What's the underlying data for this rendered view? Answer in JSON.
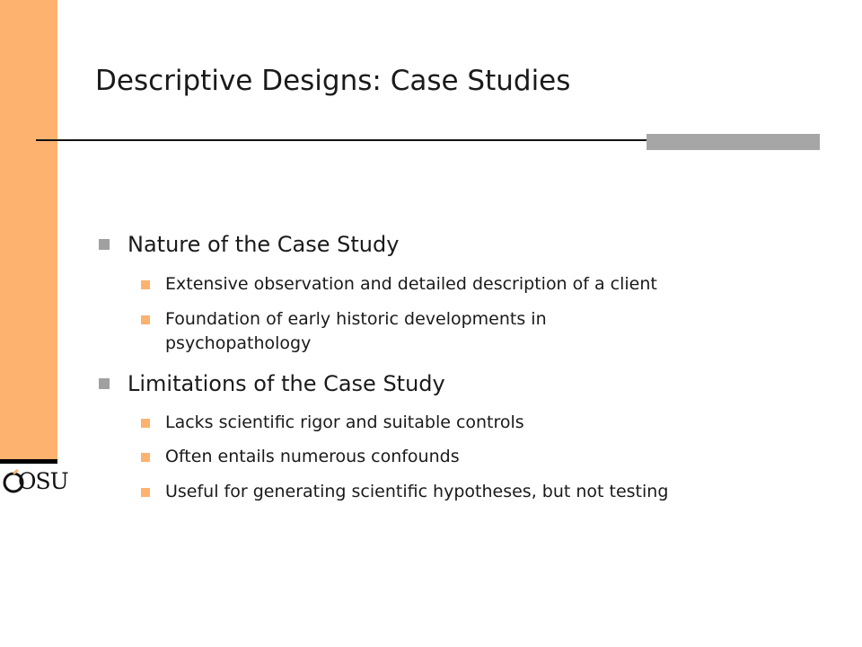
{
  "slide": {
    "title": "Descriptive Designs: Case Studies",
    "logo_text": "OSU",
    "colors": {
      "accent": "#FDB26F",
      "primary_bullet": "#A0A0A0",
      "rule_bar": "#A6A6A6"
    },
    "bullets": [
      {
        "text": "Nature of the Case Study",
        "sub": [
          "Extensive observation and detailed description of a client",
          "Foundation of early historic developments in",
          "psychopathology"
        ]
      },
      {
        "text": "Limitations of the Case Study",
        "sub": [
          "Lacks scientific rigor and suitable controls",
          "Often entails numerous confounds",
          "Useful for generating scientific hypotheses, but not testing"
        ]
      }
    ]
  }
}
